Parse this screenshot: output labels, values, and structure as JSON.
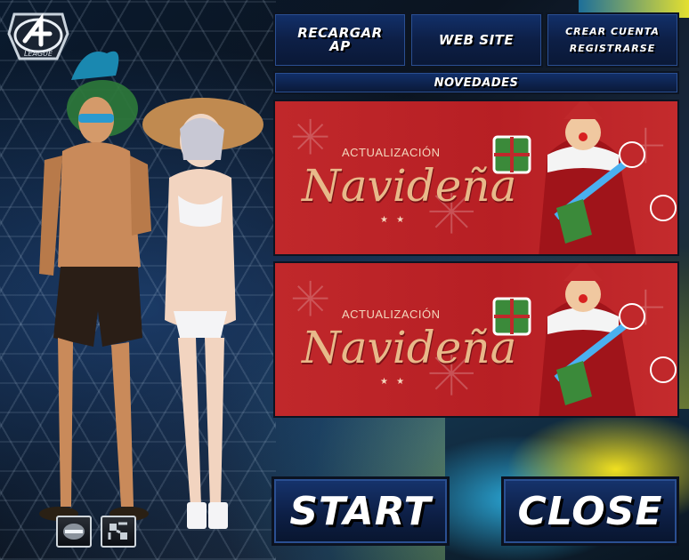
{
  "menu": {
    "recharge_label": "RECARGAR AP",
    "recharge_line1": "RECARGAR",
    "recharge_line2": "AP",
    "website_label": "WEB SITE",
    "create_account_label": "CREAR CUENTA",
    "register_label": "REGISTRARSE"
  },
  "news": {
    "header": "NOVEDADES",
    "items": [
      {
        "subtitle": "ACTUALIZACIÓN",
        "title": "Navideña",
        "stars": "★ ★"
      },
      {
        "subtitle": "ACTUALIZACIÓN",
        "title": "Navideña",
        "stars": "★ ★"
      }
    ]
  },
  "buttons": {
    "start_label": "START",
    "close_label": "CLOSE"
  },
  "logo": {
    "text": "LEAGUE"
  },
  "icons": {
    "logo": "s4-league-logo-icon",
    "control_1": "minimize-icon",
    "control_2": "settings-icon"
  },
  "colors": {
    "button_blue": "#12306a",
    "banner_red": "#c0282b",
    "banner_gold": "#e8b98a"
  }
}
